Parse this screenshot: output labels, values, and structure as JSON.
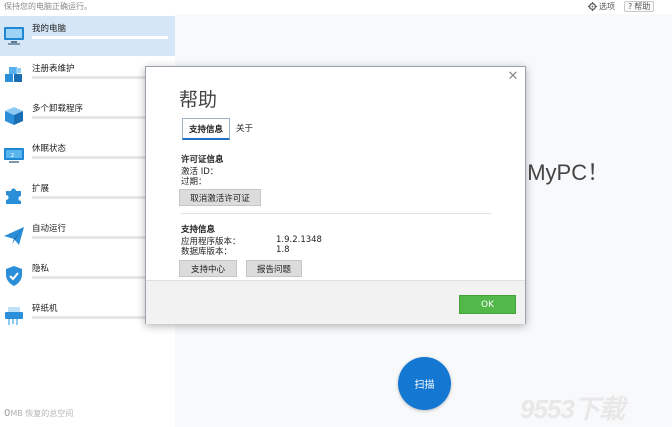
{
  "topbar": {
    "status": "保持您的电脑正确运行。",
    "settings_label": "选项",
    "help_label": "帮助"
  },
  "sidebar": {
    "items": [
      {
        "label": "我的电脑",
        "icon": "computer-icon"
      },
      {
        "label": "注册表维护",
        "icon": "registry-icon"
      },
      {
        "label": "多个卸载程序",
        "icon": "uninstall-box-icon"
      },
      {
        "label": "休眠状态",
        "icon": "hibernate-icon"
      },
      {
        "label": "扩展",
        "icon": "puzzle-icon"
      },
      {
        "label": "自动运行",
        "icon": "paper-plane-icon"
      },
      {
        "label": "隐私",
        "icon": "shield-icon"
      },
      {
        "label": "碎纸机",
        "icon": "shredder-icon"
      }
    ],
    "footer_value": "0",
    "footer_text": "MB 恢复的总空间"
  },
  "main": {
    "background_text": "nMyPC！",
    "scan_label": "扫描",
    "watermark": "9553下载"
  },
  "dialog": {
    "title": "帮助",
    "tabs": [
      "支持信息",
      "关于"
    ],
    "license": {
      "heading": "许可证信息",
      "activation_id_label": "激活 ID：",
      "expiry_label": "过期：",
      "deactivate_button": "取消激活许可证"
    },
    "support": {
      "heading": "支持信息",
      "app_version_label": "应用程序版本：",
      "app_version": "1.9.2.1348",
      "db_version_label": "数据库版本：",
      "db_version": "1.8",
      "support_center_button": "支持中心",
      "report_button": "报告问题"
    },
    "ok_label": "OK"
  },
  "colors": {
    "accent_blue": "#1478d2",
    "ok_green": "#52b849",
    "sidebar_active": "#d5e7f7"
  }
}
